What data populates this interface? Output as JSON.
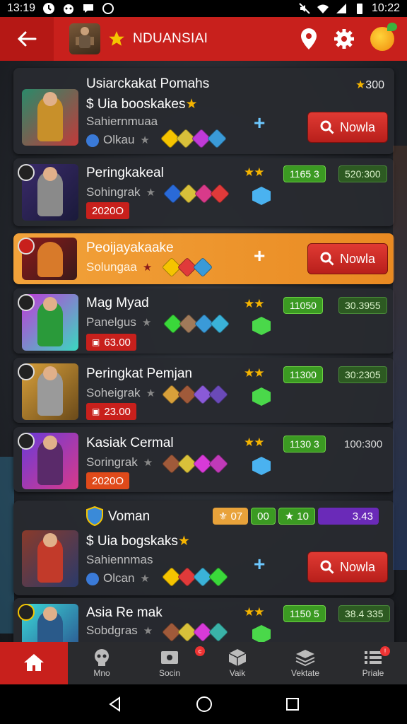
{
  "status": {
    "time_left": "13:19",
    "time_right": "10:22"
  },
  "appbar": {
    "title": "NDUANSIAI"
  },
  "cards": [
    {
      "name": "Usiarckakat Pomahs",
      "price": "$ Uia booskakes",
      "sub": "Sahiernmuaa",
      "sub2": "Olkau",
      "top_value": "300",
      "button": "Nowla"
    },
    {
      "name": "Peringkakeal",
      "sub": "Sohingrak",
      "pill": "2020O",
      "g1": "1165 3",
      "g2": "520:300"
    },
    {
      "name": "Peoijayakaake",
      "sub": "Solungaa",
      "button": "Nowla"
    },
    {
      "name": "Mag Myad",
      "sub": "Panelgus",
      "pill": "63.00",
      "g1": "11050",
      "g2": "30.3955"
    },
    {
      "name": "Peringkat Pemjan",
      "sub": "Soheigrak",
      "pill": "23.00",
      "g1": "11300",
      "g2": "30:2305"
    },
    {
      "name": "Kasiak Cermal",
      "sub": "Soringrak",
      "pill": "2020O",
      "g1": "1130 3",
      "g2": "100:300"
    },
    {
      "name": "Voman",
      "price": "$ Uia bogskaks",
      "sub": "Sahiennmas",
      "sub2": "Olcan",
      "t1": "07",
      "t2": "00",
      "t3": "10",
      "t4": "3.43",
      "button": "Nowla"
    },
    {
      "name": "Asia Re mak",
      "sub": "Sobdgras",
      "g1": "1150 5",
      "g2": "38.4 335"
    }
  ],
  "nav": [
    {
      "label": ""
    },
    {
      "label": "Mno"
    },
    {
      "label": "Socin",
      "badge": "c"
    },
    {
      "label": "Vaik"
    },
    {
      "label": "Vektate"
    },
    {
      "label": "Priale",
      "badge": "!"
    }
  ],
  "colors": {
    "appbar": "#c8201c",
    "highlight": "#f2a23a",
    "green": "#3b9a22",
    "star": "#f5b400"
  }
}
